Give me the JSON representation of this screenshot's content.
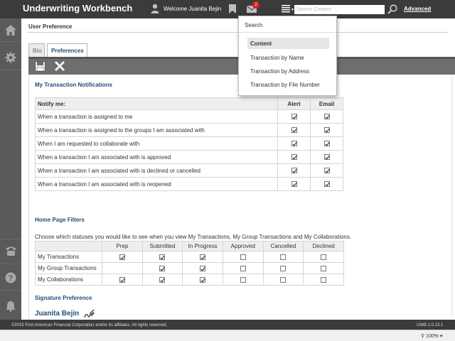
{
  "header": {
    "app_title": "Underwriting Workbench",
    "welcome": "Welcome Juanita Bejin",
    "mail_count": "2",
    "search_placeholder": "Search Content",
    "advanced": "Advanced"
  },
  "page": {
    "title": "User Preference",
    "tabs": [
      "Bio",
      "Preferences"
    ],
    "active_tab": "Preferences"
  },
  "notifications": {
    "section_title": "My Transaction Notifications",
    "columns": [
      "Notify me:",
      "Alert",
      "Email"
    ],
    "rows": [
      {
        "label": "When a transaction is assigned to me",
        "alert": true,
        "email": true
      },
      {
        "label": "When a transaction is assigned to the groups I am associated with",
        "alert": true,
        "email": true
      },
      {
        "label": "When I am requested to collaborate with",
        "alert": true,
        "email": true
      },
      {
        "label": "When a transaction I am associated with is approved",
        "alert": true,
        "email": true
      },
      {
        "label": "When a transaction I am associated with is declined or cancelled",
        "alert": true,
        "email": true
      },
      {
        "label": "When a transaction I am associated with is reopened",
        "alert": true,
        "email": true
      }
    ]
  },
  "home_filters": {
    "section_title": "Home Page Filters",
    "description": "Choose which statuses you would like to see when you view My Transactions, My Group Transactions and My Collaborations.",
    "columns": [
      "Prep",
      "Submitted",
      "In Progress",
      "Approved",
      "Cancelled",
      "Declined"
    ],
    "rows": [
      {
        "label": "My Transactions",
        "values": [
          true,
          true,
          true,
          false,
          false,
          false
        ]
      },
      {
        "label": "My Group Transactions",
        "values": [
          false,
          true,
          true,
          false,
          false,
          false
        ]
      },
      {
        "label": "My Collaborations",
        "values": [
          true,
          true,
          true,
          false,
          false,
          false
        ]
      }
    ]
  },
  "signature": {
    "section_title": "Signature Preference",
    "name": "Juanita Bejin"
  },
  "search_dropdown": {
    "header": "Search",
    "items": [
      "Content",
      "Transaction by Name",
      "Transaction by Address",
      "Transaction by File Number"
    ],
    "selected": "Content"
  },
  "footer": {
    "copyright": "©2015 First American Financial Corporation and/or its affiliates. All rights reserved.",
    "version": "UWB 1.0.13.1",
    "zoom": "100%"
  },
  "icons": [
    "user-icon",
    "bookmark-icon",
    "mail-icon",
    "menu-icon",
    "search-icon",
    "home-icon",
    "gear-icon",
    "phone-icon",
    "help-icon",
    "bell-icon",
    "save-icon",
    "close-icon",
    "signature-icon"
  ],
  "colors": {
    "accent": "#1f4e79",
    "topbar": "#3b3b3b",
    "sidebar": "#5a5a5a",
    "badge": "#d9201c"
  }
}
